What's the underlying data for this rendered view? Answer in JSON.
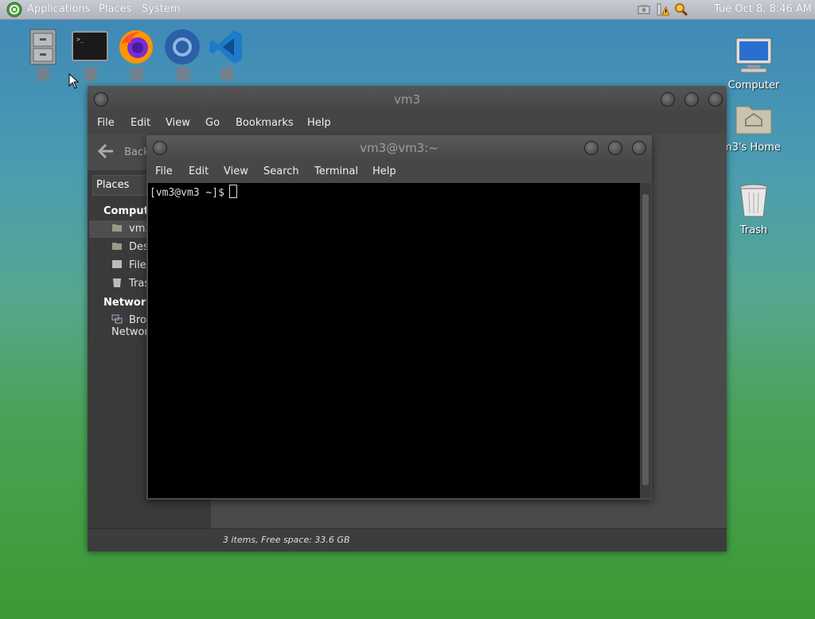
{
  "top_panel": {
    "menus": [
      "Applications",
      "Places",
      "System"
    ],
    "clock": "Tue Oct  8,  8:46 AM",
    "tray_icons": [
      "network-icon",
      "update-warning-icon",
      "search-icon"
    ]
  },
  "launchers": [
    "file-cabinet",
    "terminal",
    "firefox",
    "chrome",
    "vscode"
  ],
  "desktop_icons": [
    {
      "icon": "computer-icon",
      "label": "Computer"
    },
    {
      "icon": "home-folder-icon",
      "label": "m3's Home"
    },
    {
      "icon": "trash-icon",
      "label": "Trash"
    }
  ],
  "file_manager": {
    "title": "vm3",
    "menus": [
      "File",
      "Edit",
      "View",
      "Go",
      "Bookmarks",
      "Help"
    ],
    "back_label": "Back",
    "places_label": "Places",
    "sidebar": {
      "computer_header": "Computer",
      "computer_items": [
        "vm3",
        "Desktop",
        "File System",
        "Trash"
      ],
      "network_header": "Network",
      "network_items": [
        "Browse Network"
      ]
    },
    "status": "3 items, Free space: 33.6 GB"
  },
  "terminal": {
    "title": "vm3@vm3:~",
    "menus": [
      "File",
      "Edit",
      "View",
      "Search",
      "Terminal",
      "Help"
    ],
    "prompt": "[vm3@vm3 ~]$"
  }
}
